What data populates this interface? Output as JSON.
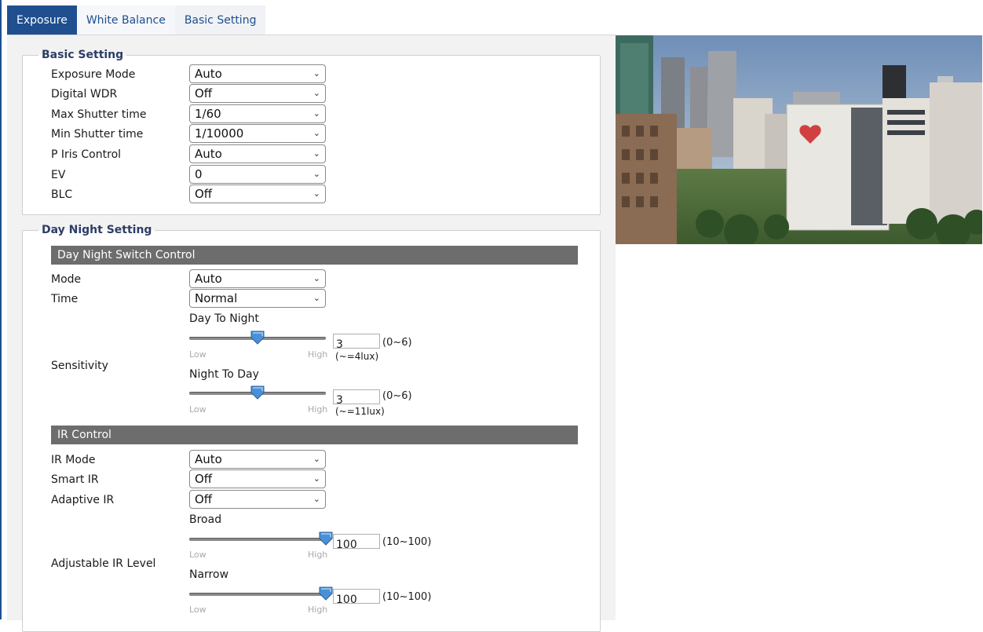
{
  "tabs": [
    {
      "label": "Exposure",
      "active": true
    },
    {
      "label": "White Balance",
      "active": false
    },
    {
      "label": "Basic Setting",
      "active": false
    }
  ],
  "basic_setting": {
    "legend": "Basic Setting",
    "rows": [
      {
        "label": "Exposure Mode",
        "value": "Auto"
      },
      {
        "label": "Digital WDR",
        "value": "Off"
      },
      {
        "label": "Max Shutter time",
        "value": "1/60"
      },
      {
        "label": "Min Shutter time",
        "value": "1/10000"
      },
      {
        "label": "P Iris Control",
        "value": "Auto"
      },
      {
        "label": "EV",
        "value": "0"
      },
      {
        "label": "BLC",
        "value": "Off"
      }
    ]
  },
  "day_night": {
    "legend": "Day Night Setting",
    "switch_header": "Day Night Switch Control",
    "mode": {
      "label": "Mode",
      "value": "Auto"
    },
    "time": {
      "label": "Time",
      "value": "Normal"
    },
    "sensitivity": {
      "label": "Sensitivity",
      "day_to_night": {
        "title": "Day To Night",
        "value": "3",
        "range": "(0~6)",
        "lux": "(~=4lux)",
        "level": 0.5
      },
      "night_to_day": {
        "title": "Night To Day",
        "value": "3",
        "range": "(0~6)",
        "lux": "(~=11lux)",
        "level": 0.5
      }
    },
    "ir_header": "IR Control",
    "ir_mode": {
      "label": "IR Mode",
      "value": "Auto"
    },
    "smart_ir": {
      "label": "Smart IR",
      "value": "Off"
    },
    "adaptive_ir": {
      "label": "Adaptive IR",
      "value": "Off"
    },
    "ir_level": {
      "label": "Adjustable IR Level",
      "broad": {
        "title": "Broad",
        "value": "100",
        "range": "(10~100)",
        "level": 1.0
      },
      "narrow": {
        "title": "Narrow",
        "value": "100",
        "range": "(10~100)",
        "level": 1.0
      }
    }
  },
  "slider_labels": {
    "low": "Low",
    "high": "High"
  },
  "preview_image": {
    "name": "city-skyline-camera-preview"
  },
  "colors": {
    "accent": "#1f4f8f",
    "section_bar": "#6d6d6d",
    "thumb": "#4a90d9"
  }
}
